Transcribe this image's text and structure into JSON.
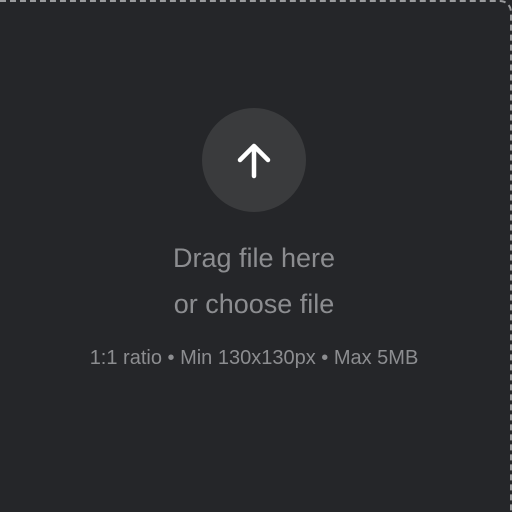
{
  "dropzone": {
    "icon": "arrow-up-icon",
    "drag_text": "Drag file here",
    "choose_text": "or choose file",
    "requirements": "1:1 ratio • Min 130x130px • Max 5MB"
  },
  "colors": {
    "background": "#252629",
    "icon_circle": "#3a3b3d",
    "icon": "#ffffff",
    "text": "#8c8d90",
    "dashed_border": "#9a9b9d"
  }
}
